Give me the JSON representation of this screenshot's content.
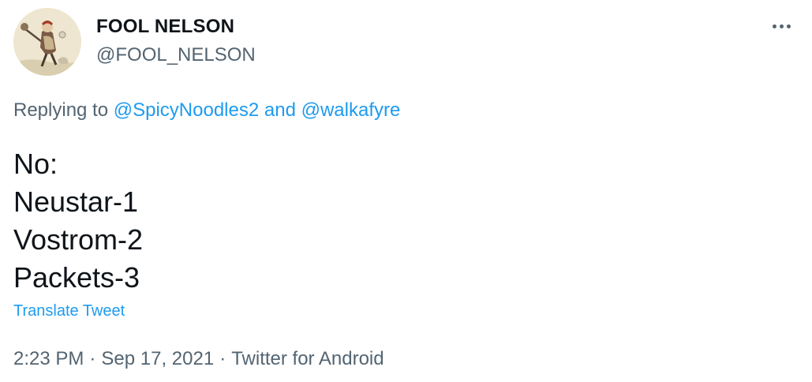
{
  "author": {
    "display_name": "FOOL NELSON",
    "handle": "@FOOL_NELSON",
    "avatar_icon": "tarot-fool-avatar"
  },
  "reply": {
    "prefix": "Replying to",
    "user1": "@SpicyNoodles2",
    "conjunction": "and",
    "user2": "@walkafyre"
  },
  "tweet": {
    "lines": [
      "No:",
      "Neustar-1",
      "Vostrom-2",
      "Packets-3"
    ],
    "translate_label": "Translate Tweet"
  },
  "meta": {
    "time": "2:23 PM",
    "separator": "·",
    "date": "Sep 17, 2021",
    "source": "Twitter for Android"
  },
  "colors": {
    "link": "#1d9bf0",
    "secondary_text": "#536471",
    "primary_text": "#0f1419"
  },
  "icons": {
    "more": "more-horizontal-icon"
  }
}
